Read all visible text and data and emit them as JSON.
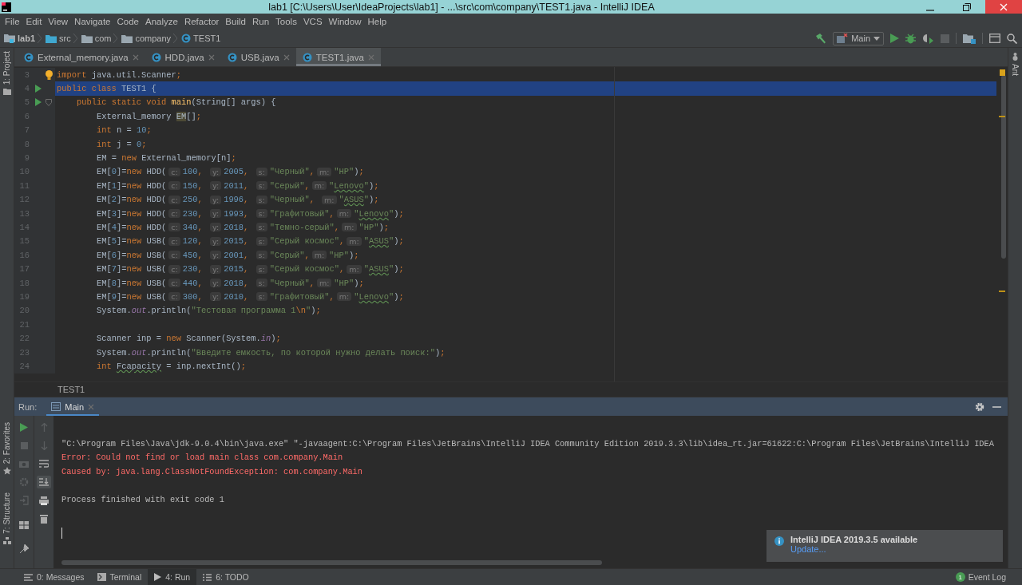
{
  "window": {
    "title": "lab1 [C:\\Users\\User\\IdeaProjects\\lab1] - ...\\src\\com\\company\\TEST1.java - IntelliJ IDEA"
  },
  "menu": [
    "File",
    "Edit",
    "View",
    "Navigate",
    "Code",
    "Analyze",
    "Refactor",
    "Build",
    "Run",
    "Tools",
    "VCS",
    "Window",
    "Help"
  ],
  "breadcrumbs": [
    {
      "label": "lab1",
      "kind": "module"
    },
    {
      "label": "src",
      "kind": "source"
    },
    {
      "label": "com",
      "kind": "package"
    },
    {
      "label": "company",
      "kind": "package"
    },
    {
      "label": "TEST1",
      "kind": "class"
    }
  ],
  "run_config": "Main",
  "left_strip": {
    "top": [
      "1: Project"
    ],
    "bottom": [
      "2: Favorites",
      "7: Structure"
    ]
  },
  "right_strip": [
    "Ant"
  ],
  "tabs": [
    {
      "label": "External_memory.java",
      "selected": false
    },
    {
      "label": "HDD.java",
      "selected": false
    },
    {
      "label": "USB.java",
      "selected": false
    },
    {
      "label": "TEST1.java",
      "selected": true
    }
  ],
  "editor": {
    "lines": [
      {
        "number": "3",
        "kind": "top",
        "selected": false,
        "runnable": false,
        "tokens": [
          {
            "kind": "kw",
            "text": "import"
          },
          {
            "kind": "plain",
            "text": " java.util.Scanner"
          },
          {
            "kind": "punct",
            "text": ";"
          }
        ]
      },
      {
        "number": "4",
        "kind": "top",
        "selected": true,
        "runnable": true,
        "tokens": [
          {
            "kind": "kw",
            "text": "public class "
          },
          {
            "kind": "plain",
            "text": "TEST1 {"
          }
        ]
      },
      {
        "number": "5",
        "kind": "member",
        "selected": false,
        "runnable": true,
        "tokens": [
          {
            "kind": "kw",
            "text": "public static void "
          },
          {
            "kind": "fn",
            "text": "main"
          },
          {
            "kind": "plain",
            "text": "(String[] args) {"
          }
        ]
      },
      {
        "number": "6",
        "kind": "body",
        "selected": false,
        "runnable": false,
        "tokens": [
          {
            "kind": "plain",
            "text": "External_memory "
          },
          {
            "kind": "ref",
            "text": "EM"
          },
          {
            "kind": "plain",
            "text": "[]"
          },
          {
            "kind": "punct",
            "text": ";"
          }
        ]
      },
      {
        "number": "7",
        "kind": "body",
        "selected": false,
        "runnable": false,
        "tokens": [
          {
            "kind": "kw",
            "text": "int "
          },
          {
            "kind": "plain",
            "text": "n = "
          },
          {
            "kind": "num",
            "text": "10"
          },
          {
            "kind": "punct",
            "text": ";"
          }
        ]
      },
      {
        "number": "8",
        "kind": "body",
        "selected": false,
        "runnable": false,
        "tokens": [
          {
            "kind": "kw",
            "text": "int "
          },
          {
            "kind": "plain",
            "text": "j = "
          },
          {
            "kind": "num",
            "text": "0"
          },
          {
            "kind": "punct",
            "text": ";"
          }
        ]
      },
      {
        "number": "9",
        "kind": "body",
        "selected": false,
        "runnable": false,
        "tokens": [
          {
            "kind": "plain",
            "text": "EM = "
          },
          {
            "kind": "kw",
            "text": "new "
          },
          {
            "kind": "plain",
            "text": "External_memory[n]"
          },
          {
            "kind": "punct",
            "text": ";"
          }
        ]
      },
      {
        "number": "10",
        "kind": "body",
        "selected": false,
        "runnable": false,
        "tokens": [
          {
            "kind": "plain",
            "text": "EM["
          },
          {
            "kind": "num",
            "text": "0"
          },
          {
            "kind": "plain",
            "text": "]="
          },
          {
            "kind": "kw",
            "text": "new "
          },
          {
            "kind": "plain",
            "text": "HDD("
          },
          {
            "kind": "hint",
            "text": "c:"
          },
          {
            "kind": "num",
            "text": "100"
          },
          {
            "kind": "punct",
            "text": ", "
          },
          {
            "kind": "hint",
            "text": "y:"
          },
          {
            "kind": "num",
            "text": "2005"
          },
          {
            "kind": "punct",
            "text": ", "
          },
          {
            "kind": "hint",
            "text": "s:"
          },
          {
            "kind": "str",
            "text": "\"Черный\""
          },
          {
            "kind": "punct",
            "text": ","
          },
          {
            "kind": "hint",
            "text": "m:"
          },
          {
            "kind": "str",
            "text": "\"HP\""
          },
          {
            "kind": "plain",
            "text": ")"
          },
          {
            "kind": "punct",
            "text": ";"
          }
        ]
      },
      {
        "number": "11",
        "kind": "body",
        "selected": false,
        "runnable": false,
        "tokens": [
          {
            "kind": "plain",
            "text": "EM["
          },
          {
            "kind": "num",
            "text": "1"
          },
          {
            "kind": "plain",
            "text": "]="
          },
          {
            "kind": "kw",
            "text": "new "
          },
          {
            "kind": "plain",
            "text": "HDD("
          },
          {
            "kind": "hint",
            "text": "c:"
          },
          {
            "kind": "num",
            "text": "150"
          },
          {
            "kind": "punct",
            "text": ", "
          },
          {
            "kind": "hint",
            "text": "y:"
          },
          {
            "kind": "num",
            "text": "2011"
          },
          {
            "kind": "punct",
            "text": ", "
          },
          {
            "kind": "hint",
            "text": "s:"
          },
          {
            "kind": "str",
            "text": "\"Серый\""
          },
          {
            "kind": "punct",
            "text": ","
          },
          {
            "kind": "hint",
            "text": "m:"
          },
          {
            "kind": "str",
            "text": "\""
          },
          {
            "kind": "misspelt",
            "text": "Lenovo"
          },
          {
            "kind": "str",
            "text": "\""
          },
          {
            "kind": "plain",
            "text": ")"
          },
          {
            "kind": "punct",
            "text": ";"
          }
        ]
      },
      {
        "number": "12",
        "kind": "body",
        "selected": false,
        "runnable": false,
        "tokens": [
          {
            "kind": "plain",
            "text": "EM["
          },
          {
            "kind": "num",
            "text": "2"
          },
          {
            "kind": "plain",
            "text": "]="
          },
          {
            "kind": "kw",
            "text": "new "
          },
          {
            "kind": "plain",
            "text": "HDD("
          },
          {
            "kind": "hint",
            "text": "c:"
          },
          {
            "kind": "num",
            "text": "250"
          },
          {
            "kind": "punct",
            "text": ", "
          },
          {
            "kind": "hint",
            "text": "y:"
          },
          {
            "kind": "num",
            "text": "1996"
          },
          {
            "kind": "punct",
            "text": ", "
          },
          {
            "kind": "hint",
            "text": "s:"
          },
          {
            "kind": "str",
            "text": "\"Черный\""
          },
          {
            "kind": "punct",
            "text": ", "
          },
          {
            "kind": "hint",
            "text": "m:"
          },
          {
            "kind": "str",
            "text": "\""
          },
          {
            "kind": "misspelt",
            "text": "ASUS"
          },
          {
            "kind": "str",
            "text": "\""
          },
          {
            "kind": "plain",
            "text": ")"
          },
          {
            "kind": "punct",
            "text": ";"
          }
        ]
      },
      {
        "number": "13",
        "kind": "body",
        "selected": false,
        "runnable": false,
        "tokens": [
          {
            "kind": "plain",
            "text": "EM["
          },
          {
            "kind": "num",
            "text": "3"
          },
          {
            "kind": "plain",
            "text": "]="
          },
          {
            "kind": "kw",
            "text": "new "
          },
          {
            "kind": "plain",
            "text": "HDD("
          },
          {
            "kind": "hint",
            "text": "c:"
          },
          {
            "kind": "num",
            "text": "230"
          },
          {
            "kind": "punct",
            "text": ", "
          },
          {
            "kind": "hint",
            "text": "y:"
          },
          {
            "kind": "num",
            "text": "1993"
          },
          {
            "kind": "punct",
            "text": ", "
          },
          {
            "kind": "hint",
            "text": "s:"
          },
          {
            "kind": "str",
            "text": "\"Графитовый\""
          },
          {
            "kind": "punct",
            "text": ","
          },
          {
            "kind": "hint",
            "text": "m:"
          },
          {
            "kind": "str",
            "text": "\""
          },
          {
            "kind": "misspelt",
            "text": "Lenovo"
          },
          {
            "kind": "str",
            "text": "\""
          },
          {
            "kind": "plain",
            "text": ")"
          },
          {
            "kind": "punct",
            "text": ";"
          }
        ]
      },
      {
        "number": "14",
        "kind": "body",
        "selected": false,
        "runnable": false,
        "tokens": [
          {
            "kind": "plain",
            "text": "EM["
          },
          {
            "kind": "num",
            "text": "4"
          },
          {
            "kind": "plain",
            "text": "]="
          },
          {
            "kind": "kw",
            "text": "new "
          },
          {
            "kind": "plain",
            "text": "HDD("
          },
          {
            "kind": "hint",
            "text": "c:"
          },
          {
            "kind": "num",
            "text": "340"
          },
          {
            "kind": "punct",
            "text": ", "
          },
          {
            "kind": "hint",
            "text": "y:"
          },
          {
            "kind": "num",
            "text": "2018"
          },
          {
            "kind": "punct",
            "text": ", "
          },
          {
            "kind": "hint",
            "text": "s:"
          },
          {
            "kind": "str",
            "text": "\"Темно-серый\""
          },
          {
            "kind": "punct",
            "text": ","
          },
          {
            "kind": "hint",
            "text": "m:"
          },
          {
            "kind": "str",
            "text": "\"HP\""
          },
          {
            "kind": "plain",
            "text": ")"
          },
          {
            "kind": "punct",
            "text": ";"
          }
        ]
      },
      {
        "number": "15",
        "kind": "body",
        "selected": false,
        "runnable": false,
        "tokens": [
          {
            "kind": "plain",
            "text": "EM["
          },
          {
            "kind": "num",
            "text": "5"
          },
          {
            "kind": "plain",
            "text": "]="
          },
          {
            "kind": "kw",
            "text": "new "
          },
          {
            "kind": "plain",
            "text": "USB("
          },
          {
            "kind": "hint",
            "text": "c:"
          },
          {
            "kind": "num",
            "text": "120"
          },
          {
            "kind": "punct",
            "text": ", "
          },
          {
            "kind": "hint",
            "text": "y:"
          },
          {
            "kind": "num",
            "text": "2015"
          },
          {
            "kind": "punct",
            "text": ", "
          },
          {
            "kind": "hint",
            "text": "s:"
          },
          {
            "kind": "str",
            "text": "\"Серый космос\""
          },
          {
            "kind": "punct",
            "text": ","
          },
          {
            "kind": "hint",
            "text": "m:"
          },
          {
            "kind": "str",
            "text": "\""
          },
          {
            "kind": "misspelt",
            "text": "ASUS"
          },
          {
            "kind": "str",
            "text": "\""
          },
          {
            "kind": "plain",
            "text": ")"
          },
          {
            "kind": "punct",
            "text": ";"
          }
        ]
      },
      {
        "number": "16",
        "kind": "body",
        "selected": false,
        "runnable": false,
        "tokens": [
          {
            "kind": "plain",
            "text": "EM["
          },
          {
            "kind": "num",
            "text": "6"
          },
          {
            "kind": "plain",
            "text": "]="
          },
          {
            "kind": "kw",
            "text": "new "
          },
          {
            "kind": "plain",
            "text": "USB("
          },
          {
            "kind": "hint",
            "text": "c:"
          },
          {
            "kind": "num",
            "text": "450"
          },
          {
            "kind": "punct",
            "text": ", "
          },
          {
            "kind": "hint",
            "text": "y:"
          },
          {
            "kind": "num",
            "text": "2001"
          },
          {
            "kind": "punct",
            "text": ", "
          },
          {
            "kind": "hint",
            "text": "s:"
          },
          {
            "kind": "str",
            "text": "\"Серый\""
          },
          {
            "kind": "punct",
            "text": ","
          },
          {
            "kind": "hint",
            "text": "m:"
          },
          {
            "kind": "str",
            "text": "\"HP\""
          },
          {
            "kind": "plain",
            "text": ")"
          },
          {
            "kind": "punct",
            "text": ";"
          }
        ]
      },
      {
        "number": "17",
        "kind": "body",
        "selected": false,
        "runnable": false,
        "tokens": [
          {
            "kind": "plain",
            "text": "EM["
          },
          {
            "kind": "num",
            "text": "7"
          },
          {
            "kind": "plain",
            "text": "]="
          },
          {
            "kind": "kw",
            "text": "new "
          },
          {
            "kind": "plain",
            "text": "USB("
          },
          {
            "kind": "hint",
            "text": "c:"
          },
          {
            "kind": "num",
            "text": "230"
          },
          {
            "kind": "punct",
            "text": ", "
          },
          {
            "kind": "hint",
            "text": "y:"
          },
          {
            "kind": "num",
            "text": "2015"
          },
          {
            "kind": "punct",
            "text": ", "
          },
          {
            "kind": "hint",
            "text": "s:"
          },
          {
            "kind": "str",
            "text": "\"Серый космос\""
          },
          {
            "kind": "punct",
            "text": ","
          },
          {
            "kind": "hint",
            "text": "m:"
          },
          {
            "kind": "str",
            "text": "\""
          },
          {
            "kind": "misspelt",
            "text": "ASUS"
          },
          {
            "kind": "str",
            "text": "\""
          },
          {
            "kind": "plain",
            "text": ")"
          },
          {
            "kind": "punct",
            "text": ";"
          }
        ]
      },
      {
        "number": "18",
        "kind": "body",
        "selected": false,
        "runnable": false,
        "tokens": [
          {
            "kind": "plain",
            "text": "EM["
          },
          {
            "kind": "num",
            "text": "8"
          },
          {
            "kind": "plain",
            "text": "]="
          },
          {
            "kind": "kw",
            "text": "new "
          },
          {
            "kind": "plain",
            "text": "USB("
          },
          {
            "kind": "hint",
            "text": "c:"
          },
          {
            "kind": "num",
            "text": "440"
          },
          {
            "kind": "punct",
            "text": ", "
          },
          {
            "kind": "hint",
            "text": "y:"
          },
          {
            "kind": "num",
            "text": "2018"
          },
          {
            "kind": "punct",
            "text": ", "
          },
          {
            "kind": "hint",
            "text": "s:"
          },
          {
            "kind": "str",
            "text": "\"Черный\""
          },
          {
            "kind": "punct",
            "text": ","
          },
          {
            "kind": "hint",
            "text": "m:"
          },
          {
            "kind": "str",
            "text": "\"HP\""
          },
          {
            "kind": "plain",
            "text": ")"
          },
          {
            "kind": "punct",
            "text": ";"
          }
        ]
      },
      {
        "number": "19",
        "kind": "body",
        "selected": false,
        "runnable": false,
        "tokens": [
          {
            "kind": "plain",
            "text": "EM["
          },
          {
            "kind": "num",
            "text": "9"
          },
          {
            "kind": "plain",
            "text": "]="
          },
          {
            "kind": "kw",
            "text": "new "
          },
          {
            "kind": "plain",
            "text": "USB("
          },
          {
            "kind": "hint",
            "text": "c:"
          },
          {
            "kind": "num",
            "text": "300"
          },
          {
            "kind": "punct",
            "text": ", "
          },
          {
            "kind": "hint",
            "text": "y:"
          },
          {
            "kind": "num",
            "text": "2010"
          },
          {
            "kind": "punct",
            "text": ", "
          },
          {
            "kind": "hint",
            "text": "s:"
          },
          {
            "kind": "str",
            "text": "\"Графитовый\""
          },
          {
            "kind": "punct",
            "text": ","
          },
          {
            "kind": "hint",
            "text": "m:"
          },
          {
            "kind": "str",
            "text": "\""
          },
          {
            "kind": "misspelt",
            "text": "Lenovo"
          },
          {
            "kind": "str",
            "text": "\""
          },
          {
            "kind": "plain",
            "text": ")"
          },
          {
            "kind": "punct",
            "text": ";"
          }
        ]
      },
      {
        "number": "20",
        "kind": "body",
        "selected": false,
        "runnable": false,
        "tokens": [
          {
            "kind": "plain",
            "text": "System."
          },
          {
            "kind": "field",
            "text": "out"
          },
          {
            "kind": "plain",
            "text": ".println("
          },
          {
            "kind": "str",
            "text": "\"Тестовая программа 1"
          },
          {
            "kind": "esc",
            "text": "\\n"
          },
          {
            "kind": "str",
            "text": "\""
          },
          {
            "kind": "plain",
            "text": ")"
          },
          {
            "kind": "punct",
            "text": ";"
          }
        ]
      },
      {
        "number": "21",
        "kind": "body",
        "selected": false,
        "runnable": false
      },
      {
        "number": "22",
        "kind": "body",
        "selected": false,
        "runnable": false,
        "tokens": [
          {
            "kind": "plain",
            "text": "Scanner inp = "
          },
          {
            "kind": "kw",
            "text": "new "
          },
          {
            "kind": "plain",
            "text": "Scanner(System."
          },
          {
            "kind": "field",
            "text": "in"
          },
          {
            "kind": "plain",
            "text": ")"
          },
          {
            "kind": "punct",
            "text": ";"
          }
        ]
      },
      {
        "number": "23",
        "kind": "body",
        "selected": false,
        "runnable": false,
        "tokens": [
          {
            "kind": "plain",
            "text": "System."
          },
          {
            "kind": "field",
            "text": "out"
          },
          {
            "kind": "plain",
            "text": ".println("
          },
          {
            "kind": "str",
            "text": "\"Введите емкость, по которой нужно делать поиск:\""
          },
          {
            "kind": "plain",
            "text": ")"
          },
          {
            "kind": "punct",
            "text": ";"
          }
        ]
      },
      {
        "number": "24",
        "kind": "body",
        "selected": false,
        "runnable": false,
        "tokens": [
          {
            "kind": "kw",
            "text": "int "
          },
          {
            "kind": "misspelt-ident",
            "text": "Fcapacity"
          },
          {
            "kind": "plain",
            "text": " = inp.nextInt()"
          },
          {
            "kind": "punct",
            "text": ";"
          }
        ]
      }
    ]
  },
  "editor_breadcrumb": "TEST1",
  "run_panel": {
    "label": "Run:",
    "tab": "Main",
    "output": [
      {
        "kind": "command",
        "text": "\"C:\\Program Files\\Java\\jdk-9.0.4\\bin\\java.exe\" \"-javaagent:C:\\Program Files\\JetBrains\\IntelliJ IDEA Community Edition 2019.3.3\\lib\\idea_rt.jar=61622:C:\\Program Files\\JetBrains\\IntelliJ IDEA"
      },
      {
        "kind": "error",
        "text": "Error: Could not find or load main class com.company.Main"
      },
      {
        "kind": "error",
        "text": "Caused by: java.lang.ClassNotFoundException: com.company.Main"
      },
      {
        "kind": "info",
        "text": "Process finished with exit code 1"
      }
    ]
  },
  "notification": {
    "title": "IntelliJ IDEA 2019.3.5 available",
    "link": "Update..."
  },
  "bottom_tabs": [
    {
      "label": "0: Messages",
      "kind": "messages",
      "selected": false
    },
    {
      "label": "Terminal",
      "kind": "terminal",
      "selected": false
    },
    {
      "label": "4: Run",
      "kind": "run",
      "selected": true
    },
    {
      "label": "6: TODO",
      "kind": "todo",
      "selected": false
    }
  ],
  "event_log": {
    "label": "Event Log",
    "count": "1"
  }
}
